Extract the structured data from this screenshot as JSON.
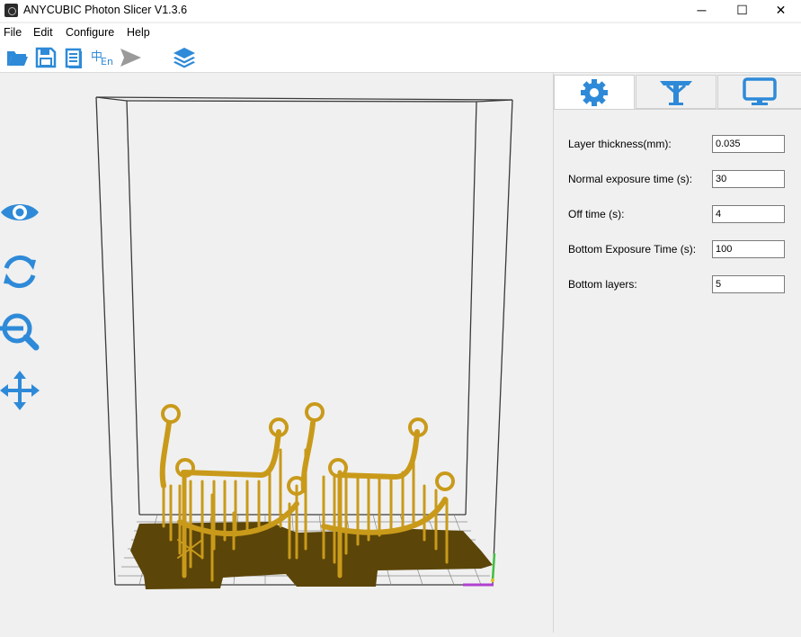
{
  "window": {
    "title": "ANYCUBIC Photon Slicer V1.3.6",
    "minimize_glyph": "─",
    "maximize_glyph": "☐",
    "close_glyph": "✕"
  },
  "menu": [
    "File",
    "Edit",
    "Configure",
    "Help"
  ],
  "toolbar": {
    "icons": [
      "open-folder-icon",
      "save-icon",
      "document-icon",
      "language-icon",
      "send-icon",
      "layers-icon"
    ],
    "language_glyph_a": "中",
    "language_glyph_b": "En"
  },
  "left_tools": [
    "eye-icon",
    "rotate-icon",
    "zoom-icon",
    "move-icon"
  ],
  "tabs": [
    "settings-gear-icon",
    "supports-icon",
    "monitor-icon"
  ],
  "settings": {
    "fields": [
      {
        "label": "Layer thickness(mm):",
        "value": "0.035"
      },
      {
        "label": "Normal exposure time (s):",
        "value": "30"
      },
      {
        "label": "Off time (s):",
        "value": "4"
      },
      {
        "label": "Bottom Exposure Time (s):",
        "value": "100"
      },
      {
        "label": "Bottom layers:",
        "value": "5"
      }
    ]
  },
  "colors": {
    "icon_blue": "#2e8ad8",
    "model_gold": "#c99a1a",
    "raft_brown": "#5b4508"
  }
}
